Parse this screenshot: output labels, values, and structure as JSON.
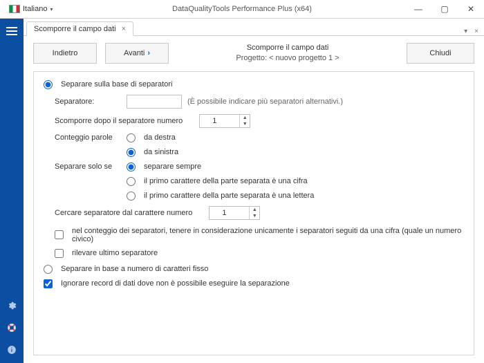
{
  "titlebar": {
    "language": "Italiano",
    "app_title": "DataQualityTools Performance Plus (x64)"
  },
  "tab": {
    "label": "Scomporre il campo dati"
  },
  "header": {
    "back": "Indietro",
    "next": "Avanti",
    "title": "Scomporre il campo dati",
    "project_prefix": "Progetto: ",
    "project_name": "< nuovo progetto 1 >",
    "close": "Chiudi"
  },
  "form": {
    "mode_separators": "Separare sulla base di separatori",
    "separator_label": "Separatore:",
    "separator_value": "",
    "separator_hint": "(È possibile indicare più separatori alternativi.)",
    "after_sep_label": "Scomporre dopo il separatore numero",
    "after_sep_value": "1",
    "word_count_label": "Conteggio parole",
    "from_right": "da destra",
    "from_left": "da sinistra",
    "only_if_label": "Separare solo se",
    "always": "separare sempre",
    "first_digit": "il primo carattere della parte separata è una cifra",
    "first_letter": "il primo carattere della parte separata è una lettera",
    "search_from_label": "Cercare separatore dal carattere numero",
    "search_from_value": "1",
    "chk_only_followed": "nel conteggio dei separatori, tenere in considerazione unicamente i separatori seguiti da una cifra (quale un numero civico)",
    "chk_last_sep": "rilevare ultimo separatore",
    "mode_fixed": "Separare in base a numero di caratteri fisso",
    "chk_ignore": "Ignorare record di dati dove non è possibile eseguire la separazione"
  }
}
